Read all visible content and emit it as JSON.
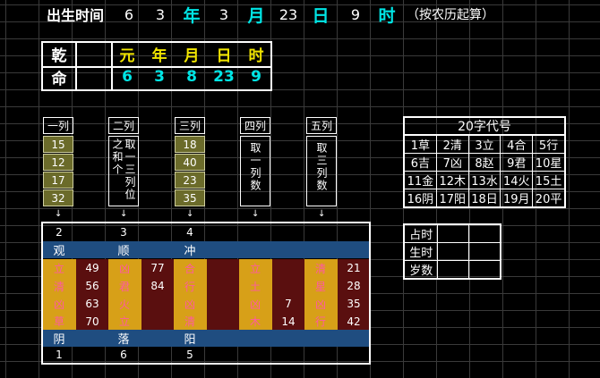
{
  "birth": {
    "label": "出生时间",
    "year_val": "6",
    "year_unit": "年",
    "month_val": "3",
    "month_unit": "月",
    "day_val": "8",
    "day_unit": "日",
    "hour_val": "23",
    "hour_unit": "时",
    "extra_val": "9",
    "note": "（按农历起算）"
  },
  "qian": {
    "title1": "乾",
    "title2": "命",
    "headers": [
      "元",
      "年",
      "月",
      "日",
      "时"
    ],
    "values": [
      "6",
      "3",
      "8",
      "23",
      "9"
    ]
  },
  "columns": {
    "col1": {
      "label": "一列",
      "values": [
        "15",
        "12",
        "17",
        "32"
      ]
    },
    "col2": {
      "label": "二列",
      "text": "取一三列位之和个"
    },
    "col3": {
      "label": "三列",
      "values": [
        "18",
        "40",
        "23",
        "35"
      ]
    },
    "col4": {
      "label": "四列",
      "text": "取一列数"
    },
    "col5": {
      "label": "五列",
      "text": "取三列数"
    }
  },
  "code_table": {
    "title": "20字代号",
    "rows": [
      [
        "1草",
        "2清",
        "3立",
        "4合",
        "5行"
      ],
      [
        "6吉",
        "7凶",
        "8赵",
        "9君",
        "10星"
      ],
      [
        "11金",
        "12木",
        "13水",
        "14火",
        "15土"
      ],
      [
        "16阴",
        "17阳",
        "18日",
        "19月",
        "20平"
      ]
    ]
  },
  "side_table": {
    "rows": [
      "占时",
      "生时",
      "岁数"
    ]
  },
  "main": {
    "top_numbers": [
      "2",
      "3",
      "4"
    ],
    "top_labels": [
      "观",
      "顺",
      "冲"
    ],
    "bottom_labels": [
      "阴",
      "落",
      "阳"
    ],
    "bottom_numbers": [
      "1",
      "6",
      "5"
    ],
    "rows": [
      {
        "a": "立",
        "a_num": "49",
        "b": "凶",
        "b_num": "77",
        "c": "合",
        "d": "立",
        "e": "清",
        "e_num": "21"
      },
      {
        "a": "清",
        "a_num": "56",
        "b": "君",
        "b_num": "84",
        "c": "行",
        "d": "土",
        "e": "星",
        "e_num": "28"
      },
      {
        "a": "凶",
        "a_num": "63",
        "b": "火",
        "c": "凶",
        "d": "凶",
        "d_num": "7",
        "e": "凶",
        "e_num": "35"
      },
      {
        "a": "草",
        "a_num": "70",
        "b": "立",
        "c": "清",
        "d": "木",
        "d_num": "14",
        "e": "行",
        "e_num": "42"
      }
    ]
  }
}
